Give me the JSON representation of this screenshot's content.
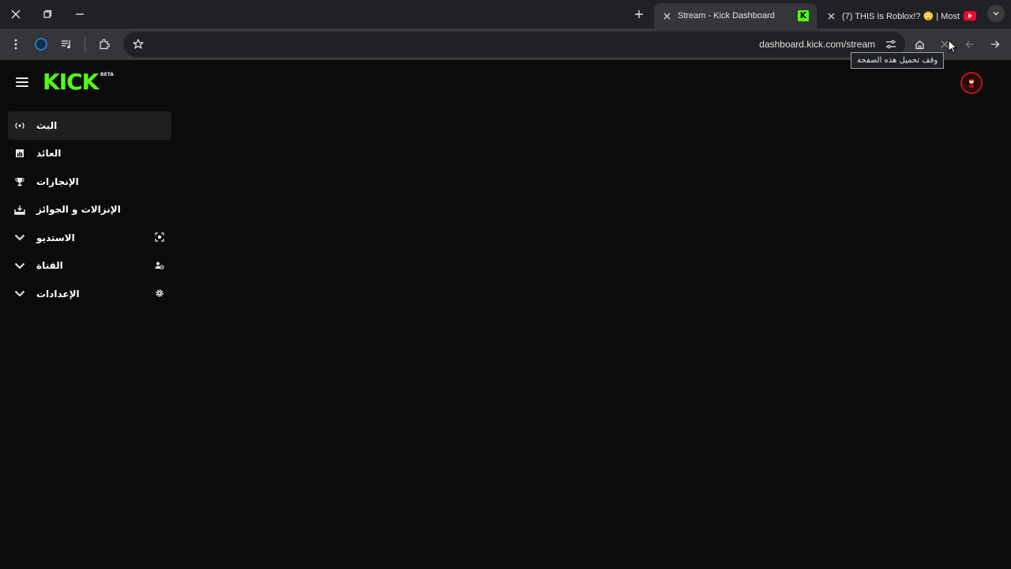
{
  "browser": {
    "tabs": [
      {
        "title": "Stream - Kick Dashboard",
        "active": true,
        "favicon": "kick-icon"
      },
      {
        "title": "(7) THIS Is Roblox!? 😳 | Most ...",
        "active": false,
        "favicon": "youtube-icon"
      }
    ],
    "url": "dashboard.kick.com/stream",
    "tooltip": "وقف تحميل هذه الصفحة"
  },
  "page": {
    "logo_text": "KICK",
    "logo_badge": "BETA",
    "nav": [
      {
        "label": "البث",
        "icon": "broadcast-icon",
        "active": true
      },
      {
        "label": "العائد",
        "icon": "revenue-icon",
        "active": false
      },
      {
        "label": "الإنجازات",
        "icon": "trophy-icon",
        "active": false
      },
      {
        "label": "الإنزالات و الجوائز",
        "icon": "drops-icon",
        "active": false
      },
      {
        "label": "الاستديو",
        "icon": "studio-icon",
        "active": false,
        "expandable": true
      },
      {
        "label": "القناة",
        "icon": "channel-icon",
        "active": false,
        "expandable": true
      },
      {
        "label": "الإعدادات",
        "icon": "settings-icon",
        "active": false,
        "expandable": true
      }
    ]
  },
  "colors": {
    "brand": "#53fc18",
    "background": "#0b0b0b",
    "chrome_dark": "#202124",
    "chrome_light": "#35363a"
  }
}
